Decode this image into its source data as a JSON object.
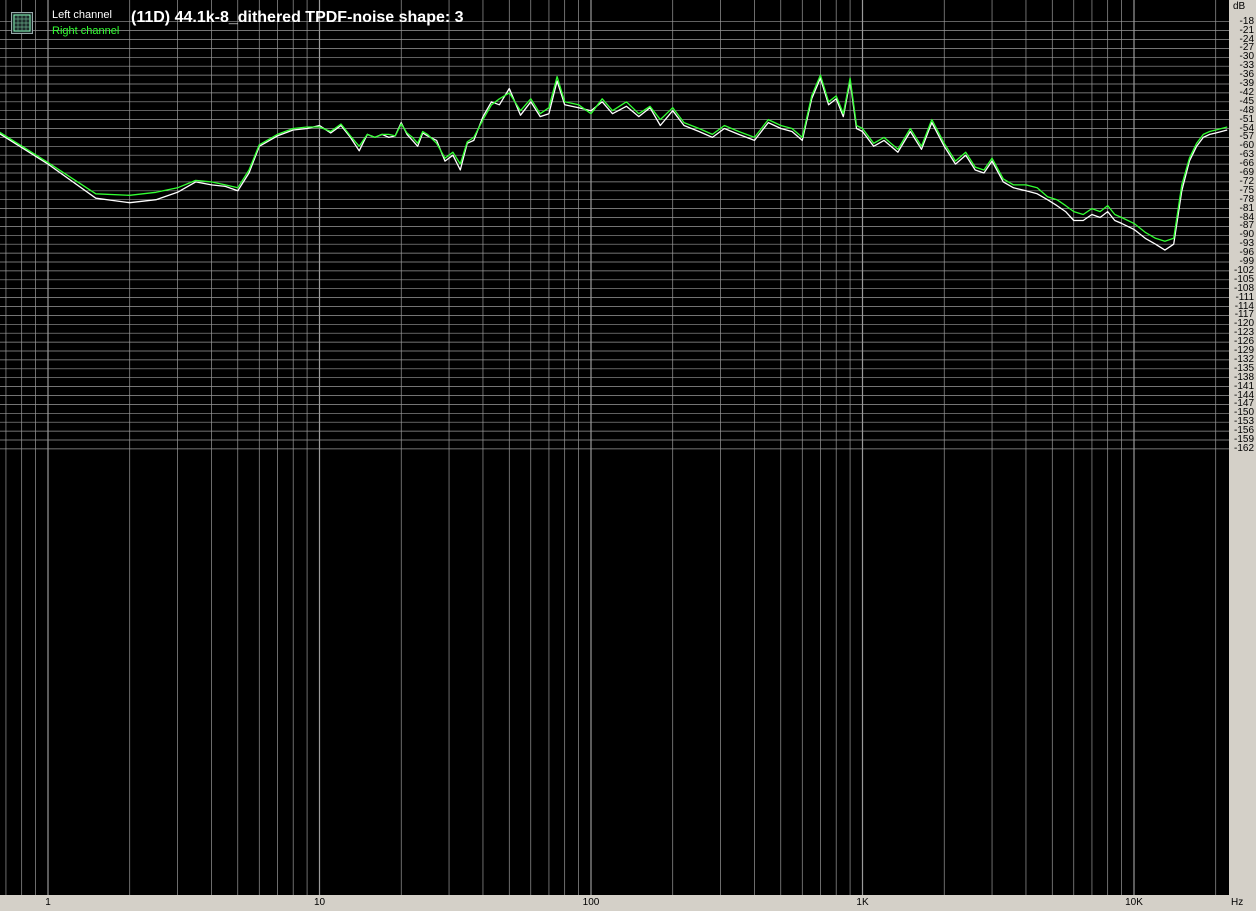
{
  "legend": {
    "icon": "spectrum-analyzer-icon",
    "left_label": "Left channel",
    "right_label": "Right channel"
  },
  "colors": {
    "background": "#000000",
    "grid": "#9a9a9a",
    "left": "#ffffff",
    "right": "#33ff33",
    "axis_panel": "#d4d0c8"
  },
  "chart_data": {
    "type": "line",
    "title": "(11D) 44.1k-8_dithered TPDF-noise shape: 3",
    "xscale": "log",
    "xunit": "Hz",
    "yunit": "dB",
    "xlim": [
      0.56,
      22050
    ],
    "ylim": [
      -162,
      -15
    ],
    "grid": true,
    "legend_position": "top-left",
    "x_tick_labels": [
      {
        "value": 1,
        "label": "1"
      },
      {
        "value": 10,
        "label": "10"
      },
      {
        "value": 100,
        "label": "100"
      },
      {
        "value": 1000,
        "label": "1K"
      },
      {
        "value": 10000,
        "label": "10K"
      }
    ],
    "y_ticks": [
      -18,
      -21,
      -24,
      -27,
      -30,
      -33,
      -36,
      -39,
      -42,
      -45,
      -48,
      -51,
      -54,
      -57,
      -60,
      -63,
      -66,
      -69,
      -72,
      -75,
      -78,
      -81,
      -84,
      -87,
      -90,
      -93,
      -96,
      -99,
      -102,
      -105,
      -108,
      -111,
      -114,
      -117,
      -120,
      -123,
      -126,
      -129,
      -132,
      -135,
      -138,
      -141,
      -144,
      -147,
      -150,
      -153,
      -156,
      -159,
      -162
    ],
    "series": [
      {
        "name": "Left channel",
        "x": [
          0.56,
          1.0,
          1.5,
          2.0,
          2.5,
          3.0,
          3.5,
          4.0,
          4.5,
          5.0,
          5.5,
          6.0,
          7.0,
          8.0,
          9.0,
          10.0,
          11.0,
          12.0,
          13.0,
          14.0,
          15.0,
          16.0,
          17.0,
          18.0,
          19.0,
          20.0,
          21.0,
          22.0,
          23.0,
          24.0,
          25.0,
          27.0,
          29.0,
          31.0,
          33.0,
          35.0,
          37.0,
          40.0,
          43.0,
          46.0,
          50.0,
          55.0,
          60.0,
          65.0,
          70.0,
          75.0,
          80.0,
          90.0,
          100.0,
          110.0,
          120.0,
          135.0,
          150.0,
          165.0,
          180.0,
          200.0,
          220.0,
          250.0,
          280.0,
          310.0,
          350.0,
          400.0,
          450.0,
          500.0,
          550.0,
          600.0,
          650.0,
          700.0,
          750.0,
          800.0,
          850.0,
          900.0,
          950.0,
          1000.0,
          1100.0,
          1200.0,
          1350.0,
          1500.0,
          1650.0,
          1800.0,
          2000.0,
          2200.0,
          2400.0,
          2600.0,
          2800.0,
          3000.0,
          3300.0,
          3600.0,
          4000.0,
          4400.0,
          4800.0,
          5200.0,
          5600.0,
          6000.0,
          6500.0,
          7000.0,
          7500.0,
          8000.0,
          8500.0,
          9000.0,
          10000.0,
          11000.0,
          12000.0,
          13000.0,
          14000.0,
          15000.0,
          16000.0,
          17000.0,
          18000.0,
          19000.0,
          20000.0,
          21000.0,
          22050.0
        ],
        "y": [
          -51.5,
          -66.0,
          -77.5,
          -79.0,
          -78.0,
          -75.5,
          -72.0,
          -73.0,
          -73.5,
          -75.0,
          -69.0,
          -60.0,
          -56.5,
          -54.5,
          -54.0,
          -53.0,
          -55.5,
          -53.0,
          -57.0,
          -61.5,
          -56.0,
          -57.0,
          -56.0,
          -57.0,
          -56.5,
          -52.0,
          -56.0,
          -58.0,
          -60.0,
          -55.5,
          -56.5,
          -58.0,
          -65.0,
          -63.0,
          -68.0,
          -59.0,
          -58.0,
          -50.0,
          -45.0,
          -46.0,
          -40.5,
          -49.5,
          -45.0,
          -50.0,
          -49.0,
          -38.0,
          -46.0,
          -47.0,
          -48.0,
          -45.0,
          -49.0,
          -46.5,
          -50.0,
          -47.0,
          -53.0,
          -48.0,
          -53.0,
          -55.0,
          -57.0,
          -54.0,
          -56.0,
          -58.0,
          -52.0,
          -54.0,
          -55.0,
          -58.0,
          -44.0,
          -37.0,
          -46.0,
          -44.0,
          -50.0,
          -38.0,
          -54.0,
          -55.0,
          -60.0,
          -58.0,
          -62.0,
          -55.0,
          -61.0,
          -52.0,
          -60.0,
          -66.0,
          -63.0,
          -68.0,
          -69.0,
          -65.0,
          -72.0,
          -74.0,
          -75.0,
          -76.0,
          -78.0,
          -80.0,
          -82.0,
          -85.0,
          -85.0,
          -83.0,
          -84.0,
          -82.0,
          -85.0,
          -86.0,
          -88.0,
          -91.0,
          -93.0,
          -95.0,
          -93.0,
          -75.0,
          -65.0,
          -60.0,
          -57.0,
          -56.0,
          -55.5,
          -55.0,
          -54.5
        ]
      },
      {
        "name": "Right channel",
        "x": [
          0.56,
          1.0,
          1.5,
          2.0,
          2.5,
          3.0,
          3.5,
          4.0,
          4.5,
          5.0,
          5.5,
          6.0,
          7.0,
          8.0,
          9.0,
          10.0,
          11.0,
          12.0,
          13.0,
          14.0,
          15.0,
          16.0,
          17.0,
          18.0,
          19.0,
          20.0,
          21.0,
          22.0,
          23.0,
          24.0,
          25.0,
          27.0,
          29.0,
          31.0,
          33.0,
          35.0,
          37.0,
          40.0,
          43.0,
          46.0,
          50.0,
          55.0,
          60.0,
          65.0,
          70.0,
          75.0,
          80.0,
          90.0,
          100.0,
          110.0,
          120.0,
          135.0,
          150.0,
          165.0,
          180.0,
          200.0,
          220.0,
          250.0,
          280.0,
          310.0,
          350.0,
          400.0,
          450.0,
          500.0,
          550.0,
          600.0,
          650.0,
          700.0,
          750.0,
          800.0,
          850.0,
          900.0,
          950.0,
          1000.0,
          1100.0,
          1200.0,
          1350.0,
          1500.0,
          1650.0,
          1800.0,
          2000.0,
          2200.0,
          2400.0,
          2600.0,
          2800.0,
          3000.0,
          3300.0,
          3600.0,
          4000.0,
          4400.0,
          4800.0,
          5200.0,
          5600.0,
          6000.0,
          6500.0,
          7000.0,
          7500.0,
          8000.0,
          8500.0,
          9000.0,
          10000.0,
          11000.0,
          12000.0,
          13000.0,
          14000.0,
          15000.0,
          16000.0,
          17000.0,
          18000.0,
          19000.0,
          20000.0,
          21000.0,
          22050.0
        ],
        "y": [
          -51.0,
          -65.5,
          -76.0,
          -76.5,
          -75.5,
          -74.0,
          -71.5,
          -72.0,
          -73.0,
          -74.0,
          -68.0,
          -59.5,
          -56.0,
          -54.0,
          -53.5,
          -53.5,
          -55.0,
          -52.5,
          -56.5,
          -60.0,
          -56.0,
          -57.0,
          -56.0,
          -56.0,
          -56.5,
          -52.5,
          -55.5,
          -57.0,
          -59.0,
          -55.0,
          -56.0,
          -59.0,
          -64.0,
          -62.0,
          -66.0,
          -58.5,
          -57.0,
          -51.0,
          -46.0,
          -44.0,
          -42.0,
          -48.0,
          -44.0,
          -49.0,
          -47.0,
          -36.5,
          -45.0,
          -46.0,
          -49.0,
          -44.0,
          -48.0,
          -45.0,
          -49.0,
          -46.5,
          -51.0,
          -47.0,
          -52.0,
          -54.0,
          -56.0,
          -53.0,
          -55.0,
          -57.0,
          -51.0,
          -53.0,
          -54.0,
          -57.0,
          -43.0,
          -36.0,
          -45.0,
          -43.0,
          -49.0,
          -37.0,
          -53.0,
          -54.0,
          -59.0,
          -57.0,
          -61.0,
          -54.0,
          -60.0,
          -51.0,
          -59.0,
          -65.0,
          -62.0,
          -67.0,
          -68.0,
          -64.0,
          -71.0,
          -73.0,
          -73.0,
          -74.0,
          -77.0,
          -78.0,
          -80.0,
          -82.0,
          -83.0,
          -81.0,
          -82.0,
          -80.0,
          -83.0,
          -84.0,
          -86.0,
          -89.0,
          -91.0,
          -92.0,
          -91.0,
          -73.0,
          -64.0,
          -59.0,
          -56.0,
          -55.0,
          -54.5,
          -54.0,
          -53.5
        ]
      }
    ]
  }
}
